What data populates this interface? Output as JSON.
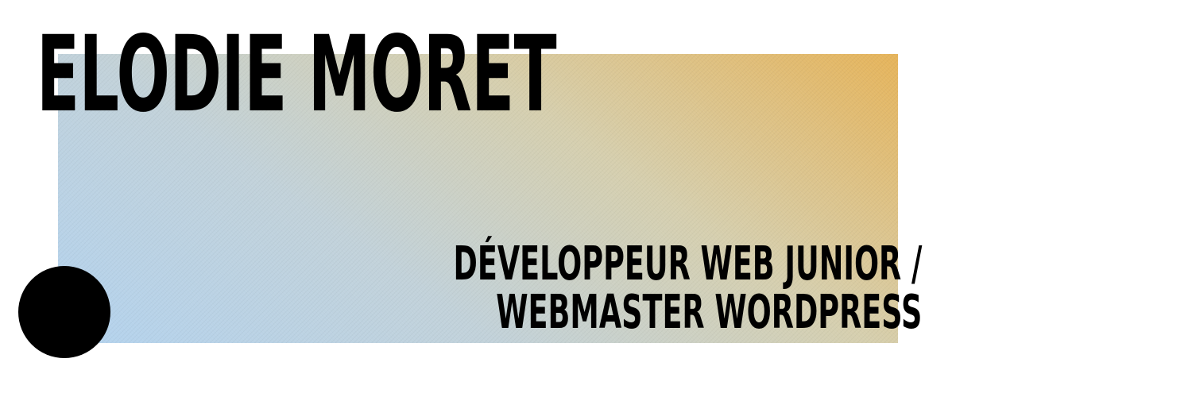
{
  "banner": {
    "name": "ELODIE MORET",
    "job_line_1": "DÉVELOPPEUR WEB JUNIOR /",
    "job_line_2": "WEBMASTER WORDPRESS"
  },
  "colors": {
    "background": "#ffffff",
    "text": "#000000",
    "gradient_blue": "#b3d3ef",
    "gradient_orange": "#e6b45a",
    "dot": "#000000"
  }
}
